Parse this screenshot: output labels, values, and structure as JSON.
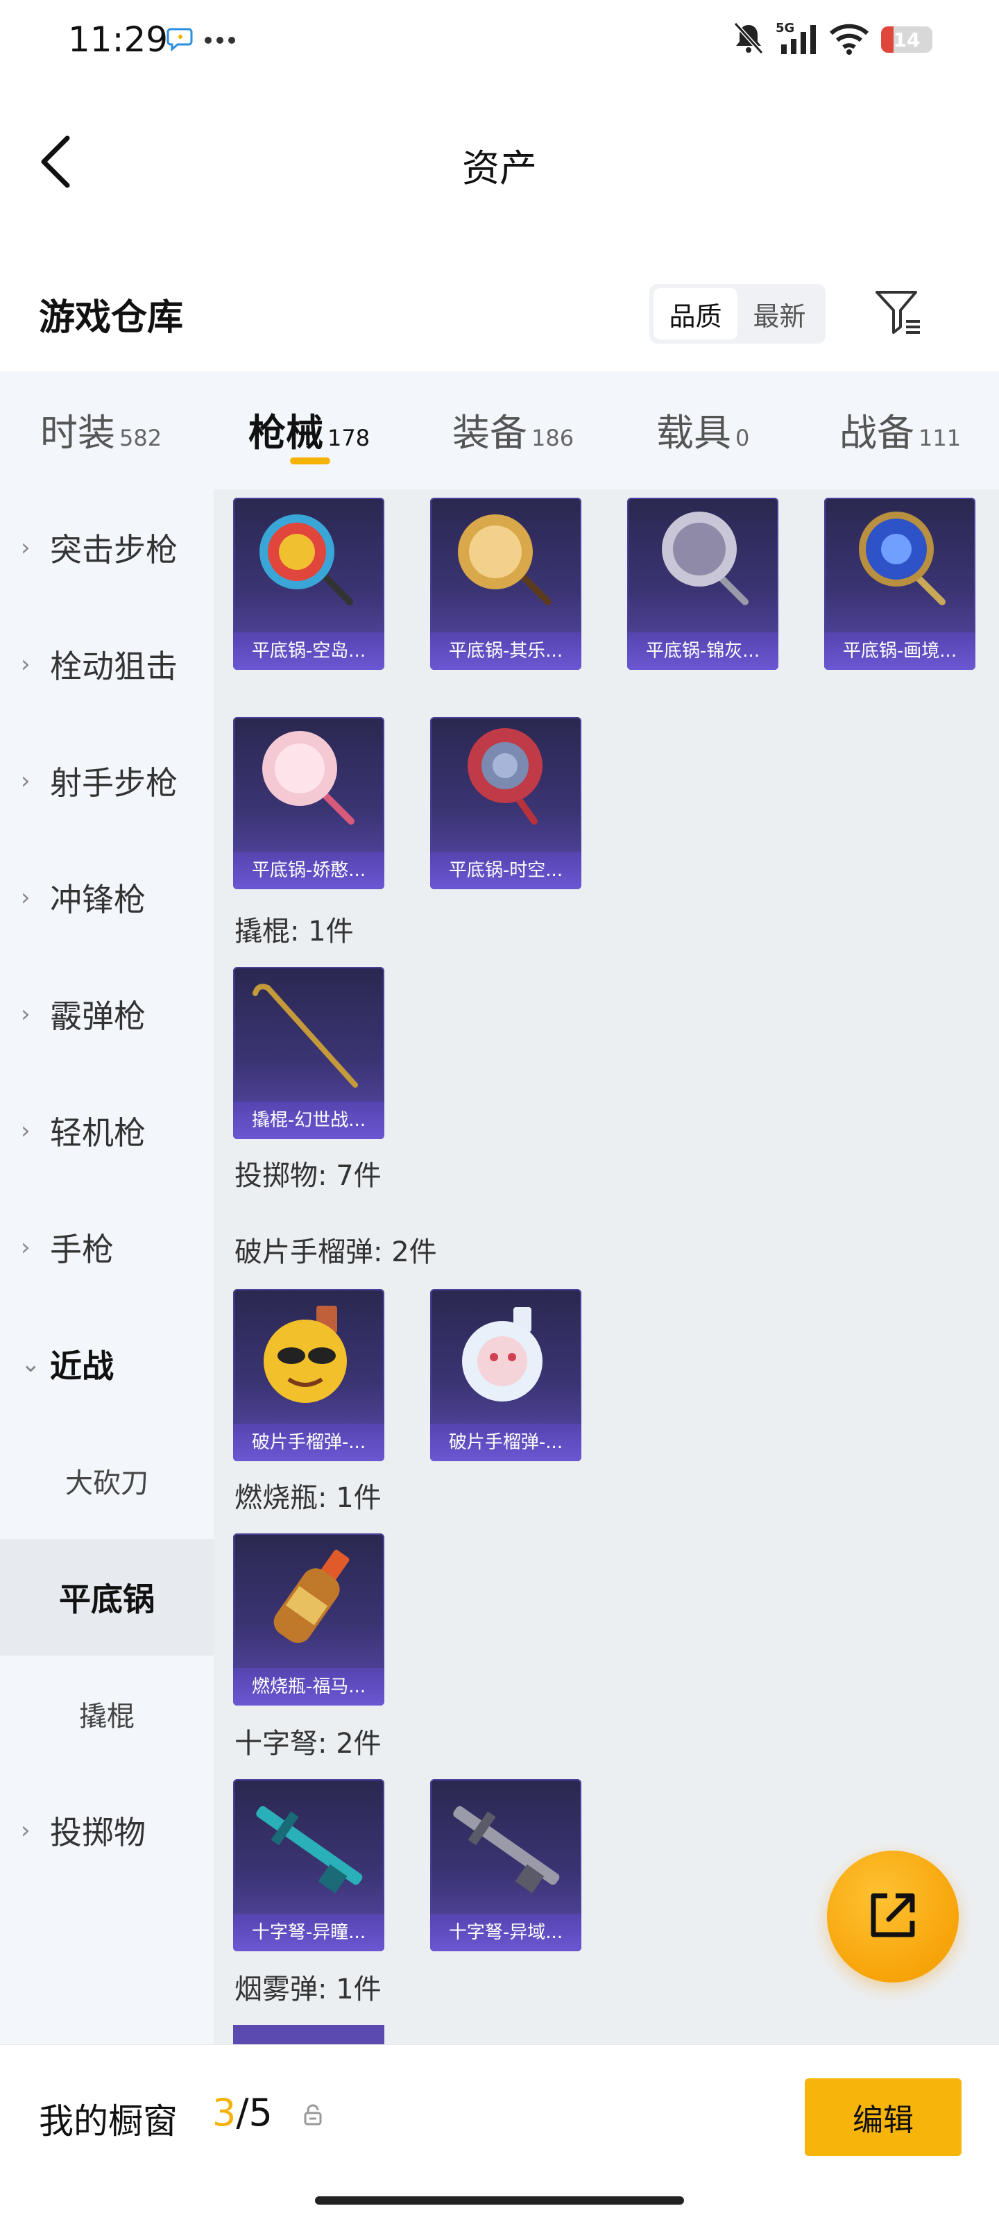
{
  "status_bar": {
    "time": "11:29",
    "network": "5G",
    "battery": "14",
    "icons": [
      "chat-bubble-icon",
      "more-dots-icon",
      "mute-bell-icon",
      "signal-icon",
      "wifi-icon",
      "battery-icon"
    ]
  },
  "header": {
    "title": "资产",
    "back_icon": "chevron-left-icon"
  },
  "warehouse": {
    "title": "游戏仓库",
    "sort_options": [
      "品质",
      "最新"
    ],
    "sort_selected": "品质",
    "filter_icon": "filter-icon"
  },
  "tabs": [
    {
      "label": "时装",
      "count": "582"
    },
    {
      "label": "枪械",
      "count": "178",
      "active": true
    },
    {
      "label": "装备",
      "count": "186"
    },
    {
      "label": "载具",
      "count": "0"
    },
    {
      "label": "战备",
      "count": "111"
    }
  ],
  "sidebar": {
    "items": [
      {
        "label": "突击步枪",
        "icon": "chevron-right-icon"
      },
      {
        "label": "栓动狙击",
        "icon": "chevron-right-icon"
      },
      {
        "label": "射手步枪",
        "icon": "chevron-right-icon"
      },
      {
        "label": "冲锋枪",
        "icon": "chevron-right-icon"
      },
      {
        "label": "霰弹枪",
        "icon": "chevron-right-icon"
      },
      {
        "label": "轻机枪",
        "icon": "chevron-right-icon"
      },
      {
        "label": "手枪",
        "icon": "chevron-right-icon"
      },
      {
        "label": "近战",
        "icon": "chevron-down-icon",
        "expanded": true
      },
      {
        "label": "投掷物",
        "icon": "chevron-right-icon"
      }
    ],
    "sub_items": [
      {
        "label": "大砍刀"
      },
      {
        "label": "平底锅",
        "active": true
      },
      {
        "label": "撬棍"
      }
    ]
  },
  "content": {
    "pan_items": [
      "平底锅-空岛...",
      "平底锅-其乐...",
      "平底锅-锦灰...",
      "平底锅-画境...",
      "平底锅-娇憨...",
      "平底锅-时空..."
    ],
    "groups": [
      {
        "label": "撬棍: 1件",
        "items": [
          "撬棍-幻世战..."
        ]
      },
      {
        "label": "投掷物: 7件",
        "items": []
      },
      {
        "label": "破片手榴弹: 2件",
        "items": [
          "破片手榴弹-...",
          "破片手榴弹-..."
        ]
      },
      {
        "label": "燃烧瓶: 1件",
        "items": [
          "燃烧瓶-福马..."
        ]
      },
      {
        "label": "十字弩: 2件",
        "items": [
          "十字弩-异瞳...",
          "十字弩-异域..."
        ]
      },
      {
        "label": "烟雾弹: 1件",
        "items": []
      }
    ]
  },
  "fab": {
    "icon": "external-link-icon"
  },
  "bottom_bar": {
    "label": "我的橱窗",
    "current": "3",
    "total": "/5",
    "lock_icon": "lock-icon",
    "edit_label": "编辑"
  },
  "colors": {
    "accent": "#f5b30a",
    "card_bg": "#3b3474",
    "card_caption": "#6b57d2"
  }
}
